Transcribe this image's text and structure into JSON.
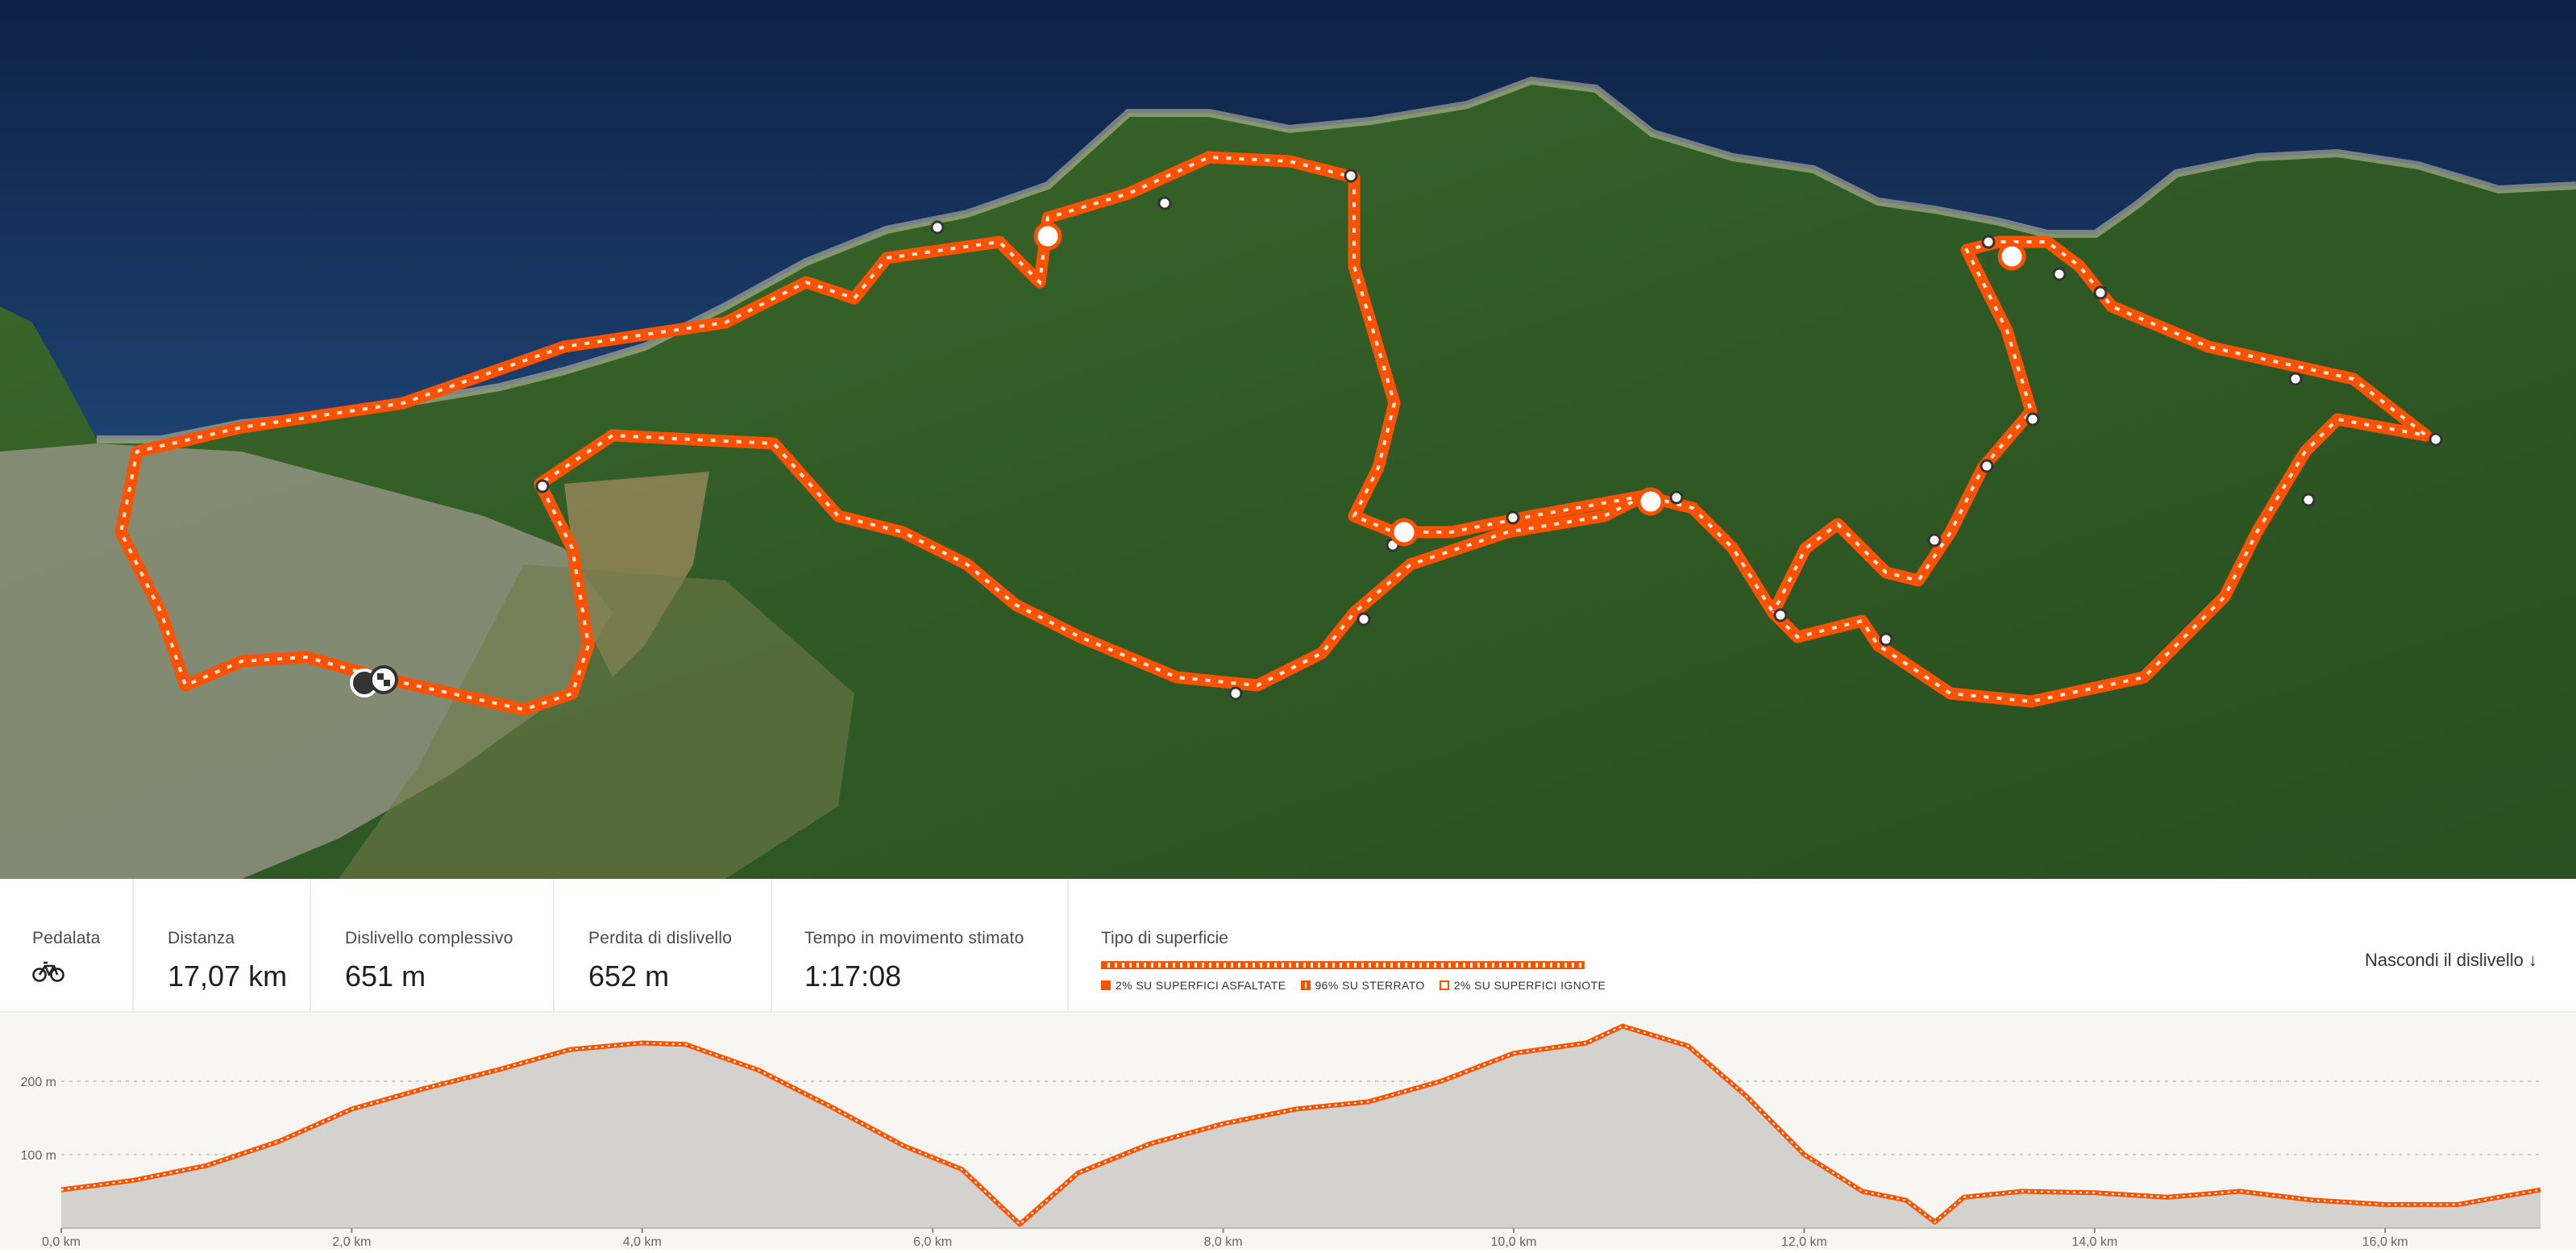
{
  "map": {
    "colors": {
      "sea": "#10284f",
      "land": "#2f5a25",
      "route": "#fc5200"
    }
  },
  "stats": {
    "activity_label": "Pedalata",
    "activity_icon": "bicycle-icon",
    "distance_label": "Distanza",
    "distance_value": "17,07 km",
    "elev_gain_label": "Dislivello complessivo",
    "elev_gain_value": "651 m",
    "elev_loss_label": "Perdita di dislivello",
    "elev_loss_value": "652 m",
    "moving_time_label": "Tempo in movimento stimato",
    "moving_time_value": "1:17:08",
    "surface_label": "Tipo di superficie",
    "surface_legend": [
      "2% SU SUPERFICI ASFALTATE",
      "96% SU STERRATO",
      "2% SU SUPERFICI IGNOTE"
    ],
    "toggle_label": "Nascondi il dislivello",
    "toggle_icon": "arrow-down-icon"
  },
  "chart_data": {
    "type": "area",
    "title": "",
    "xlabel": "",
    "ylabel": "",
    "x_tick_labels": [
      "0,0 km",
      "2,0 km",
      "4,0 km",
      "6,0 km",
      "8,0 km",
      "10,0 km",
      "12,0 km",
      "14,0 km",
      "16,0 km"
    ],
    "y_tick_labels": [
      "100 m",
      "200 m"
    ],
    "xlim": [
      0,
      17.07
    ],
    "ylim": [
      0,
      280
    ],
    "grid": true,
    "color": "#fc5200",
    "fill": "#d4d2ce",
    "x": [
      0,
      0.5,
      1,
      1.5,
      2,
      2.5,
      3,
      3.5,
      4,
      4.3,
      4.8,
      5.3,
      5.8,
      6.2,
      6.6,
      7,
      7.5,
      8,
      8.5,
      9,
      9.5,
      10,
      10.5,
      10.75,
      11.2,
      11.6,
      12,
      12.4,
      12.7,
      12.9,
      13.1,
      13.5,
      14,
      14.5,
      15,
      15.5,
      16,
      16.5,
      17.07
    ],
    "y": [
      52,
      65,
      85,
      118,
      162,
      190,
      215,
      243,
      252,
      250,
      215,
      165,
      112,
      80,
      5,
      75,
      115,
      142,
      162,
      172,
      200,
      238,
      252,
      275,
      248,
      180,
      100,
      50,
      38,
      8,
      42,
      50,
      48,
      42,
      50,
      38,
      32,
      32,
      52
    ]
  }
}
